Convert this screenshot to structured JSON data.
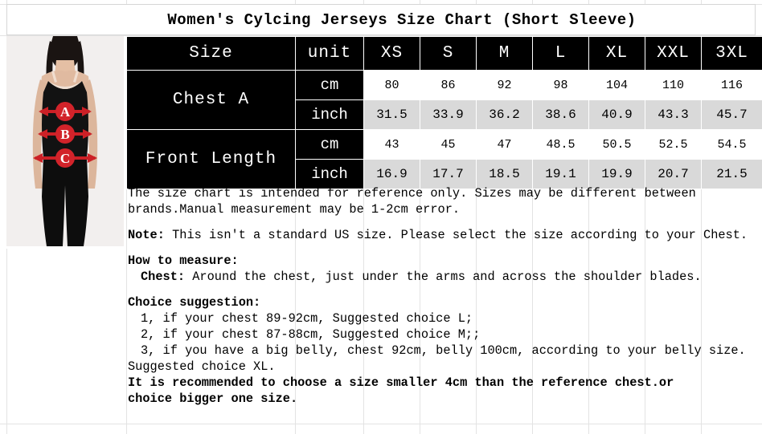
{
  "title": "Women's Cylcing Jerseys Size Chart (Short Sleeve)",
  "photo": {
    "alt": "woman wearing black tank top and leggings with measurement arrows",
    "markers": [
      {
        "letter": "A",
        "meaning": "chest"
      },
      {
        "letter": "B",
        "meaning": "waist"
      },
      {
        "letter": "C",
        "meaning": "hips"
      }
    ],
    "arrow_color": "#cc2026"
  },
  "chart_data": {
    "type": "table",
    "title": "Women's Cylcing Jerseys Size Chart (Short Sleeve)",
    "columns": [
      "Size",
      "unit",
      "XS",
      "S",
      "M",
      "L",
      "XL",
      "XXL",
      "3XL"
    ],
    "sizes": [
      "XS",
      "S",
      "M",
      "L",
      "XL",
      "XXL",
      "3XL"
    ],
    "measurements": [
      {
        "label": "Chest A",
        "units": [
          {
            "unit": "cm",
            "values": [
              "80",
              "86",
              "92",
              "98",
              "104",
              "110",
              "116"
            ]
          },
          {
            "unit": "inch",
            "values": [
              "31.5",
              "33.9",
              "36.2",
              "38.6",
              "40.9",
              "43.3",
              "45.7"
            ]
          }
        ]
      },
      {
        "label": "Front Length",
        "units": [
          {
            "unit": "cm",
            "values": [
              "43",
              "45",
              "47",
              "48.5",
              "50.5",
              "52.5",
              "54.5"
            ]
          },
          {
            "unit": "inch",
            "values": [
              "16.9",
              "17.7",
              "18.5",
              "19.1",
              "19.9",
              "20.7",
              "21.5"
            ]
          }
        ]
      }
    ],
    "header_background": "#000000",
    "header_color": "#ffffff",
    "inch_row_background": "#d9d9d9"
  },
  "table": {
    "header": {
      "size": "Size",
      "unit": "unit",
      "xs": "XS",
      "s": "S",
      "m": "M",
      "l": "L",
      "xl": "XL",
      "xxl": "XXL",
      "xxxl": "3XL"
    },
    "chest": {
      "label": "Chest A",
      "cm_unit": "cm",
      "inch_unit": "inch",
      "cm": [
        "80",
        "86",
        "92",
        "98",
        "104",
        "110",
        "116"
      ],
      "inch": [
        "31.5",
        "33.9",
        "36.2",
        "38.6",
        "40.9",
        "43.3",
        "45.7"
      ]
    },
    "front_length": {
      "label": "Front Length",
      "cm_unit": "cm",
      "inch_unit": "inch",
      "cm": [
        "43",
        "45",
        "47",
        "48.5",
        "50.5",
        "52.5",
        "54.5"
      ],
      "inch": [
        "16.9",
        "17.7",
        "18.5",
        "19.1",
        "19.9",
        "20.7",
        "21.5"
      ]
    }
  },
  "notes": {
    "disclaimer_line1": "The size chart is intended for reference only. Sizes may be different between",
    "disclaimer_line2": "brands.Manual measurement may be 1-2cm error.",
    "note_label": "Note:",
    "note_text": " This isn't a standard US size. Please select the size according to your Chest.",
    "how_to_measure_heading": "How to measure:",
    "chest_label": "Chest:",
    "chest_text": " Around the chest, just under the arms and across the shoulder blades.",
    "choice_heading": "Choice suggestion:",
    "choice_items": [
      "1, if your chest 89-92cm, Suggested choice L;",
      "2, if your chest 87-88cm, Suggested choice M;;",
      "3, if you have a big belly, chest 92cm, belly 100cm, according to your belly size."
    ],
    "choice_tail": "Suggested choice XL.",
    "recommend_line1": "It is recommended to choose a size smaller 4cm than the reference chest.or",
    "recommend_line2": "choice bigger one size."
  }
}
